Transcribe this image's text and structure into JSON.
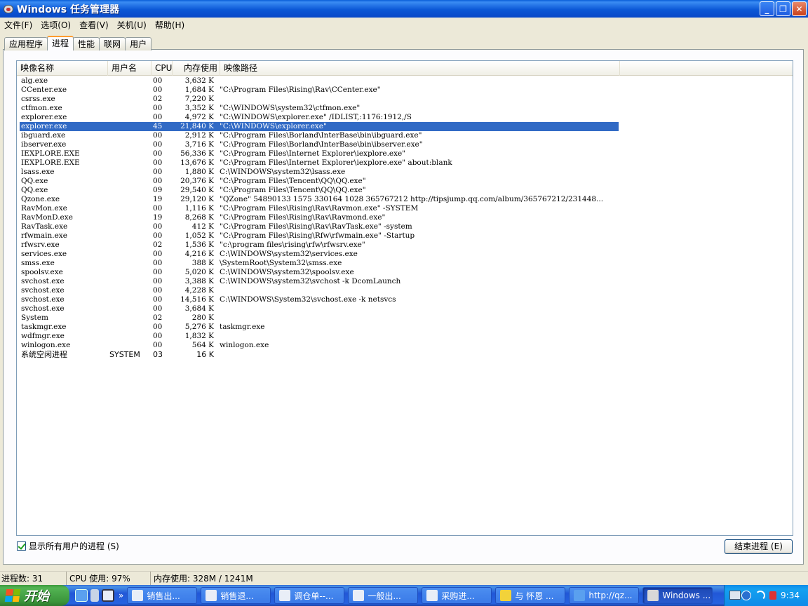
{
  "window": {
    "title": "Windows 任务管理器"
  },
  "menu": [
    "文件(F)",
    "选项(O)",
    "查看(V)",
    "关机(U)",
    "帮助(H)"
  ],
  "tabs": [
    "应用程序",
    "进程",
    "性能",
    "联网",
    "用户"
  ],
  "active_tab": 1,
  "columns": {
    "name": "映像名称",
    "user": "用户名",
    "cpu": "CPU",
    "mem": "内存使用",
    "path": "映像路径"
  },
  "processes": [
    {
      "name": "alg.exe",
      "user": "",
      "cpu": "00",
      "mem": "3,632 K",
      "path": ""
    },
    {
      "name": "CCenter.exe",
      "user": "",
      "cpu": "00",
      "mem": "1,684 K",
      "path": "\"C:\\Program Files\\Rising\\Rav\\CCenter.exe\""
    },
    {
      "name": "csrss.exe",
      "user": "",
      "cpu": "02",
      "mem": "7,220 K",
      "path": ""
    },
    {
      "name": "ctfmon.exe",
      "user": "",
      "cpu": "00",
      "mem": "3,352 K",
      "path": "\"C:\\WINDOWS\\system32\\ctfmon.exe\""
    },
    {
      "name": "explorer.exe",
      "user": "",
      "cpu": "00",
      "mem": "4,972 K",
      "path": "\"C:\\WINDOWS\\explorer.exe\" /IDLIST,:1176:1912,/S"
    },
    {
      "name": "explorer.exe",
      "user": "",
      "cpu": "45",
      "mem": "21,840 K",
      "path": "\"C:\\WINDOWS\\explorer.exe\"",
      "selected": true
    },
    {
      "name": "ibguard.exe",
      "user": "",
      "cpu": "00",
      "mem": "2,912 K",
      "path": "\"C:\\Program Files\\Borland\\InterBase\\bin\\ibguard.exe\""
    },
    {
      "name": "ibserver.exe",
      "user": "",
      "cpu": "00",
      "mem": "3,716 K",
      "path": "\"C:\\Program Files\\Borland\\InterBase\\bin\\ibserver.exe\""
    },
    {
      "name": "IEXPLORE.EXE",
      "user": "",
      "cpu": "00",
      "mem": "56,336 K",
      "path": "\"C:\\Program Files\\Internet Explorer\\iexplore.exe\""
    },
    {
      "name": "IEXPLORE.EXE",
      "user": "",
      "cpu": "00",
      "mem": "13,676 K",
      "path": "\"C:\\Program Files\\Internet Explorer\\iexplore.exe\" about:blank"
    },
    {
      "name": "lsass.exe",
      "user": "",
      "cpu": "00",
      "mem": "1,880 K",
      "path": "C:\\WINDOWS\\system32\\lsass.exe"
    },
    {
      "name": "QQ.exe",
      "user": "",
      "cpu": "00",
      "mem": "20,376 K",
      "path": "\"C:\\Program Files\\Tencent\\QQ\\QQ.exe\""
    },
    {
      "name": "QQ.exe",
      "user": "",
      "cpu": "09",
      "mem": "29,540 K",
      "path": "\"C:\\Program Files\\Tencent\\QQ\\QQ.exe\""
    },
    {
      "name": "Qzone.exe",
      "user": "",
      "cpu": "19",
      "mem": "29,120 K",
      "path": "\"QZone\" 54890133 1575 330164 1028 365767212 http://tipsjump.qq.com/album/365767212/231448..."
    },
    {
      "name": "RavMon.exe",
      "user": "",
      "cpu": "00",
      "mem": "1,116 K",
      "path": "\"C:\\Program Files\\Rising\\Rav\\Ravmon.exe\" -SYSTEM"
    },
    {
      "name": "RavMonD.exe",
      "user": "",
      "cpu": "19",
      "mem": "8,268 K",
      "path": "\"C:\\Program Files\\Rising\\Rav\\Ravmond.exe\""
    },
    {
      "name": "RavTask.exe",
      "user": "",
      "cpu": "00",
      "mem": "412 K",
      "path": "\"C:\\Program Files\\Rising\\Rav\\RavTask.exe\" -system"
    },
    {
      "name": "rfwmain.exe",
      "user": "",
      "cpu": "00",
      "mem": "1,052 K",
      "path": "\"C:\\Program Files\\Rising\\Rfw\\rfwmain.exe\" -Startup"
    },
    {
      "name": "rfwsrv.exe",
      "user": "",
      "cpu": "02",
      "mem": "1,536 K",
      "path": "\"c:\\program files\\rising\\rfw\\rfwsrv.exe\""
    },
    {
      "name": "services.exe",
      "user": "",
      "cpu": "00",
      "mem": "4,216 K",
      "path": "C:\\WINDOWS\\system32\\services.exe"
    },
    {
      "name": "smss.exe",
      "user": "",
      "cpu": "00",
      "mem": "388 K",
      "path": "\\SystemRoot\\System32\\smss.exe"
    },
    {
      "name": "spoolsv.exe",
      "user": "",
      "cpu": "00",
      "mem": "5,020 K",
      "path": "C:\\WINDOWS\\system32\\spoolsv.exe"
    },
    {
      "name": "svchost.exe",
      "user": "",
      "cpu": "00",
      "mem": "3,388 K",
      "path": "C:\\WINDOWS\\system32\\svchost -k DcomLaunch"
    },
    {
      "name": "svchost.exe",
      "user": "",
      "cpu": "00",
      "mem": "4,228 K",
      "path": ""
    },
    {
      "name": "svchost.exe",
      "user": "",
      "cpu": "00",
      "mem": "14,516 K",
      "path": "C:\\WINDOWS\\System32\\svchost.exe -k netsvcs"
    },
    {
      "name": "svchost.exe",
      "user": "",
      "cpu": "00",
      "mem": "3,684 K",
      "path": ""
    },
    {
      "name": "System",
      "user": "",
      "cpu": "02",
      "mem": "280 K",
      "path": ""
    },
    {
      "name": "taskmgr.exe",
      "user": "",
      "cpu": "00",
      "mem": "5,276 K",
      "path": "taskmgr.exe"
    },
    {
      "name": "wdfmgr.exe",
      "user": "",
      "cpu": "00",
      "mem": "1,832 K",
      "path": ""
    },
    {
      "name": "winlogon.exe",
      "user": "",
      "cpu": "00",
      "mem": "564 K",
      "path": "winlogon.exe"
    },
    {
      "name": "系统空闲进程",
      "user": "SYSTEM",
      "cpu": "03",
      "mem": "16 K",
      "path": "",
      "big": true
    }
  ],
  "show_all_users": {
    "label": "显示所有用户的进程 (S)",
    "checked": true
  },
  "end_process_button": "结束进程 (E)",
  "status": {
    "processes": "进程数: 31",
    "cpu": "CPU 使用: 97%",
    "memory": "内存使用: 328M / 1241M"
  },
  "taskbar": {
    "start_label": "开始",
    "more": "»",
    "buttons": [
      {
        "label": "销售出...",
        "icon": "ie-doc-icon"
      },
      {
        "label": "销售退...",
        "icon": "ie-doc-icon"
      },
      {
        "label": "调仓单--...",
        "icon": "ie-doc-icon"
      },
      {
        "label": "一般出...",
        "icon": "ie-doc-icon"
      },
      {
        "label": "采购进...",
        "icon": "ie-doc-icon"
      },
      {
        "label": "与 怀恩 ...",
        "icon": "qq-chat-icon"
      },
      {
        "label": "http://qz...",
        "icon": "ie-icon"
      },
      {
        "label": "Windows ...",
        "icon": "taskmgr-icon",
        "active": true
      }
    ],
    "clock": "9:34"
  },
  "colors": {
    "titlebar": "#0c58d6",
    "selection": "#316ac5",
    "taskbar": "#2157d7",
    "start": "#3a943a",
    "tray": "#0f8ae8"
  }
}
